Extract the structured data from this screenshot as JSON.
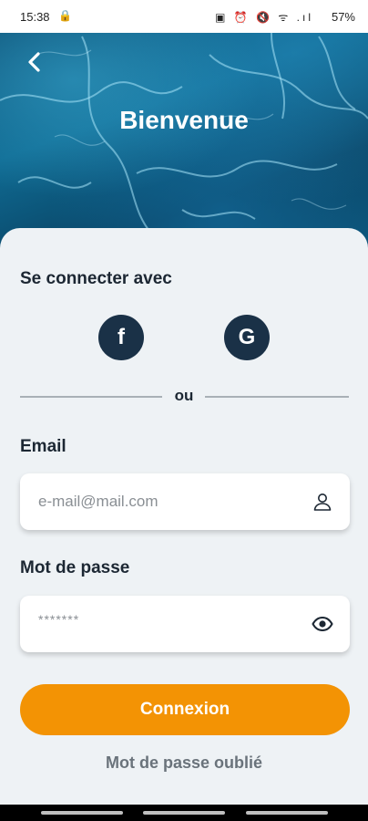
{
  "status_bar": {
    "time": "15:38",
    "battery": "57%"
  },
  "header": {
    "title": "Bienvenue"
  },
  "social_login": {
    "label": "Se connecter avec",
    "providers": [
      {
        "name": "Facebook",
        "glyph": "f",
        "icon": "facebook-icon"
      },
      {
        "name": "Google",
        "glyph": "G",
        "icon": "google-icon"
      }
    ],
    "separator": "ou"
  },
  "email": {
    "label": "Email",
    "placeholder": "e-mail@mail.com",
    "icon": "user-icon"
  },
  "password": {
    "label": "Mot de passe",
    "masked_value": "*******",
    "icon": "eye-icon"
  },
  "actions": {
    "login_label": "Connexion",
    "forgot_label": "Mot de passe oublié"
  },
  "colors": {
    "accent": "#f39304",
    "social_bg": "#1a3147",
    "card_bg": "#eef2f5",
    "text_dark": "#1c2733"
  }
}
